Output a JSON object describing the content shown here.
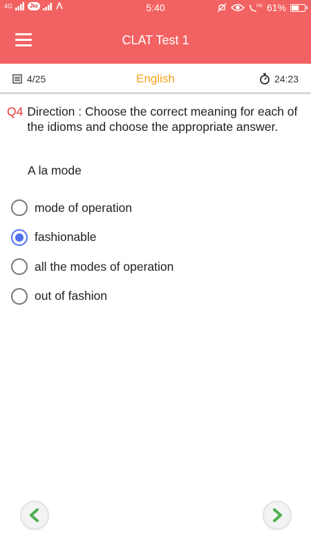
{
  "status_bar": {
    "time": "5:40",
    "network_left": "4G",
    "carrier_badge": "Jio",
    "battery": "61%",
    "battery_level": 0.61
  },
  "app_bar": {
    "title": "CLAT Test 1",
    "menu_icon": "hamburger-menu-icon"
  },
  "info_bar": {
    "progress": "4/25",
    "language": "English",
    "timer": "24:23"
  },
  "question": {
    "number": "Q4",
    "text": "Direction : Choose the correct meaning for each of the idioms and choose the appropriate answer.",
    "phrase": "A la mode"
  },
  "options": [
    {
      "label": "mode of operation",
      "selected": false
    },
    {
      "label": "fashionable",
      "selected": true
    },
    {
      "label": "all the modes of operation",
      "selected": false
    },
    {
      "label": "out of fashion",
      "selected": false
    }
  ],
  "navigation": {
    "prev_icon": "chevron-left-icon",
    "next_icon": "chevron-right-icon"
  },
  "colors": {
    "accent": "#f36262",
    "language": "#f7a21b",
    "question_number": "#e53935",
    "radio_selected": "#4f6ff0",
    "nav_arrow": "#4caf50"
  }
}
